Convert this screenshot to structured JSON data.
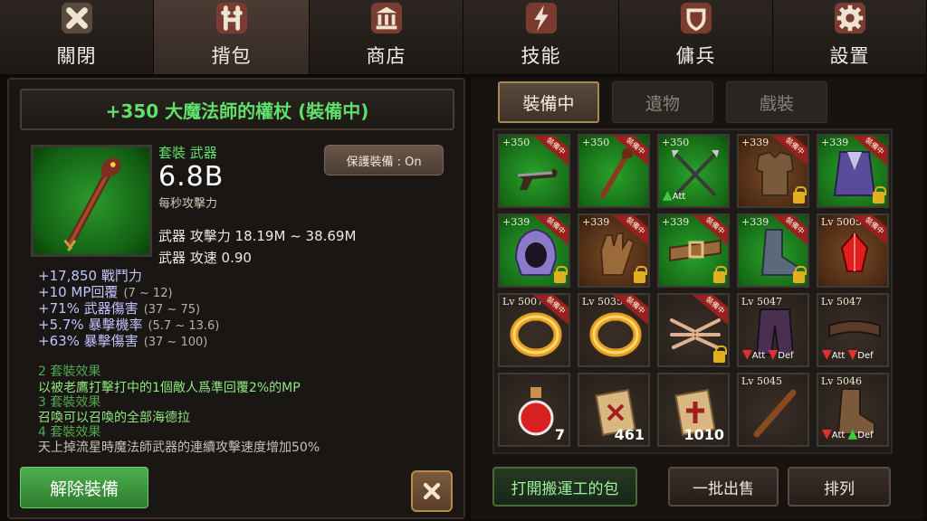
{
  "tabs": [
    {
      "label": "關閉",
      "icon": "close-x-icon"
    },
    {
      "label": "揹包",
      "icon": "backpack-icon"
    },
    {
      "label": "商店",
      "icon": "shop-building-icon"
    },
    {
      "label": "技能",
      "icon": "lightning-icon"
    },
    {
      "label": "傭兵",
      "icon": "shield-icon"
    },
    {
      "label": "設置",
      "icon": "gear-icon"
    }
  ],
  "item": {
    "title": "+350 大魔法師的權杖 (裝備中)",
    "set_label": "套裝 武器",
    "dps_value": "6.8B",
    "dps_label": "每秒攻擊力",
    "protect_label": "保護裝備 : On",
    "attack": "武器 攻擊力 18.19M ~ 38.69M",
    "speed": "武器 攻速 0.90",
    "bonuses": [
      {
        "text": "+17,850 戰鬥力",
        "range": ""
      },
      {
        "text": "+10 MP回覆",
        "range": "(7 ~ 12)"
      },
      {
        "text": "+71% 武器傷害",
        "range": "(37 ~ 75)"
      },
      {
        "text": "+5.7% 暴擊機率",
        "range": "(5.7 ~ 13.6)"
      },
      {
        "text": "+63% 暴擊傷害",
        "range": "(37 ~ 100)"
      }
    ],
    "set_effects": [
      {
        "head": "2 套裝效果",
        "desc": "以被老鷹打擊打中的1個敵人爲準回覆2%的MP"
      },
      {
        "head": "3 套裝效果",
        "desc": "召喚可以召喚的全部海德拉"
      },
      {
        "head": "4 套裝效果",
        "desc": "天上掉流星時魔法師武器的連續攻擊速度增加50%"
      }
    ],
    "unequip_label": "解除裝備"
  },
  "filter_tabs": [
    "裝備中",
    "遺物",
    "戲裝"
  ],
  "equipped_badge": "裝備中",
  "att_label": "Att",
  "def_label": "Def",
  "slots": [
    {
      "lv": "+350",
      "bg": "green",
      "icon": "pistol-icon",
      "equipped": true,
      "lock": false
    },
    {
      "lv": "+350",
      "bg": "green",
      "icon": "staff-icon",
      "equipped": true,
      "lock": false
    },
    {
      "lv": "+350",
      "bg": "green",
      "icon": "crossed-spears-icon",
      "equipped": false,
      "lock": false,
      "att_up": true
    },
    {
      "lv": "+339",
      "bg": "brown",
      "icon": "chest-armor-icon",
      "equipped": true,
      "lock": true
    },
    {
      "lv": "+339",
      "bg": "green",
      "icon": "cape-icon",
      "equipped": true,
      "lock": true
    },
    {
      "lv": "+339",
      "bg": "green",
      "icon": "hood-icon",
      "equipped": true,
      "lock": true
    },
    {
      "lv": "+339",
      "bg": "brown",
      "icon": "glove-icon",
      "equipped": true,
      "lock": true
    },
    {
      "lv": "+339",
      "bg": "green",
      "icon": "belt-icon",
      "equipped": true,
      "lock": true
    },
    {
      "lv": "+339",
      "bg": "green",
      "icon": "boot-icon",
      "equipped": true,
      "lock": true
    },
    {
      "lv": "Lv 5005",
      "bg": "brown",
      "icon": "red-gem-icon",
      "equipped": true,
      "lock": false
    },
    {
      "lv": "Lv 5007",
      "bg": "dark",
      "icon": "gold-ring-icon",
      "equipped": true,
      "lock": false
    },
    {
      "lv": "Lv 5035",
      "bg": "dark",
      "icon": "gold-ring-icon",
      "equipped": true,
      "lock": false
    },
    {
      "lv": "",
      "bg": "dark",
      "icon": "bone-wings-icon",
      "equipped": true,
      "lock": true
    },
    {
      "lv": "Lv 5047",
      "bg": "dark",
      "icon": "pants-icon",
      "equipped": false,
      "lock": false,
      "att_down": true,
      "def_down": true
    },
    {
      "lv": "Lv 5047",
      "bg": "dark",
      "icon": "belt-dark-icon",
      "equipped": false,
      "lock": false,
      "att_down": true,
      "def_down": true
    },
    {
      "lv": "",
      "bg": "dark",
      "icon": "red-potion-icon",
      "count": "7",
      "equipped": false,
      "lock": false
    },
    {
      "lv": "",
      "bg": "dark",
      "icon": "scroll-icon",
      "count": "461",
      "equipped": false,
      "lock": false
    },
    {
      "lv": "",
      "bg": "dark",
      "icon": "scroll-red-icon",
      "count": "1010",
      "equipped": false,
      "lock": false
    },
    {
      "lv": "Lv 5045",
      "bg": "dark",
      "icon": "wand-icon",
      "equipped": false,
      "lock": false
    },
    {
      "lv": "Lv 5046",
      "bg": "dark",
      "icon": "boots-icon",
      "equipped": false,
      "lock": false,
      "att_down": true,
      "def_up": true
    }
  ],
  "bottom_buttons": [
    "打開搬運工的包",
    "一批出售",
    "排列"
  ]
}
